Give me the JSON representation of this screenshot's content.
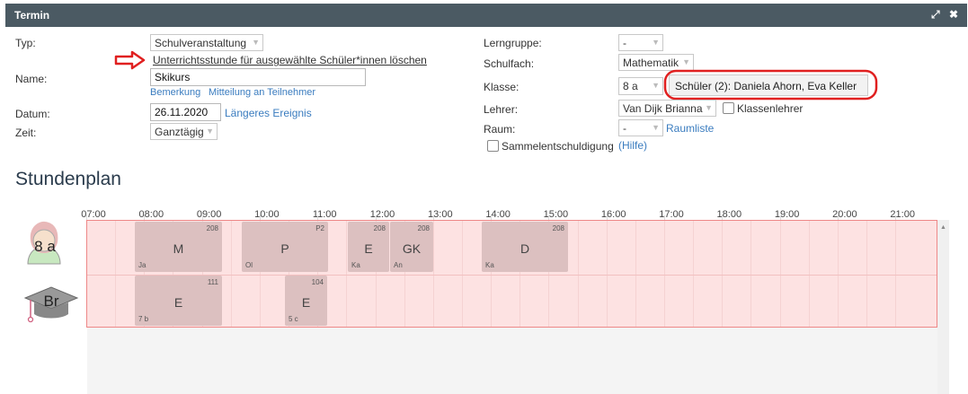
{
  "window": {
    "title": "Termin",
    "resize_icon": "expand-icon",
    "close_icon": "close-icon"
  },
  "form": {
    "typ": {
      "label": "Typ:",
      "value": "Schulveranstaltung"
    },
    "delete_link": "Unterrichtsstunde für ausgewählte Schüler*innen löschen",
    "name": {
      "label": "Name:",
      "value": "Skikurs"
    },
    "bemerkung": "Bemerkung",
    "mitteilung": "Mitteilung an Teilnehmer",
    "datum": {
      "label": "Datum:",
      "value": "26.11.2020"
    },
    "laengeres": "Längeres Ereignis",
    "zeit": {
      "label": "Zeit:",
      "value": "Ganztägig"
    },
    "lerngruppe": {
      "label": "Lerngruppe:",
      "value": "-"
    },
    "schulfach": {
      "label": "Schulfach:",
      "value": "Mathematik"
    },
    "klasse": {
      "label": "Klasse:",
      "value": "8 a"
    },
    "schueler": "Schüler (2): Daniela Ahorn, Eva Keller",
    "lehrer": {
      "label": "Lehrer:",
      "value": "Van Dijk Brianna"
    },
    "klassenlehrer": "Klassenlehrer",
    "raum": {
      "label": "Raum:",
      "value": "-"
    },
    "raumliste": "Raumliste",
    "sammel": "Sammelentschuldigung",
    "hilfe": "(Hilfe)"
  },
  "stundenplan": {
    "heading": "Stundenplan",
    "hours": [
      "07:00",
      "08:00",
      "09:00",
      "10:00",
      "11:00",
      "12:00",
      "13:00",
      "14:00",
      "15:00",
      "16:00",
      "17:00",
      "18:00",
      "19:00",
      "20:00",
      "21:00"
    ],
    "rows": [
      {
        "avatar_label": "8 a",
        "avatar_icon": "student-avatar-icon",
        "lessons": [
          {
            "subject": "M",
            "room": "208",
            "teacher": "Ja"
          },
          {
            "subject": "P",
            "room": "P2",
            "teacher": "Ol"
          },
          {
            "subject": "E",
            "room": "208",
            "teacher": "Ka"
          },
          {
            "subject": "GK",
            "room": "208",
            "teacher": "An"
          },
          {
            "subject": "D",
            "room": "208",
            "teacher": "Ka"
          }
        ]
      },
      {
        "avatar_label": "Br",
        "avatar_icon": "graduation-cap-icon",
        "lessons": [
          {
            "subject": "E",
            "room": "111",
            "teacher": "7 b"
          },
          {
            "subject": "E",
            "room": "104",
            "teacher": "5 c"
          }
        ]
      }
    ]
  },
  "annotations": {
    "arrow_color": "#e02020",
    "highlight_color": "#e02020"
  }
}
